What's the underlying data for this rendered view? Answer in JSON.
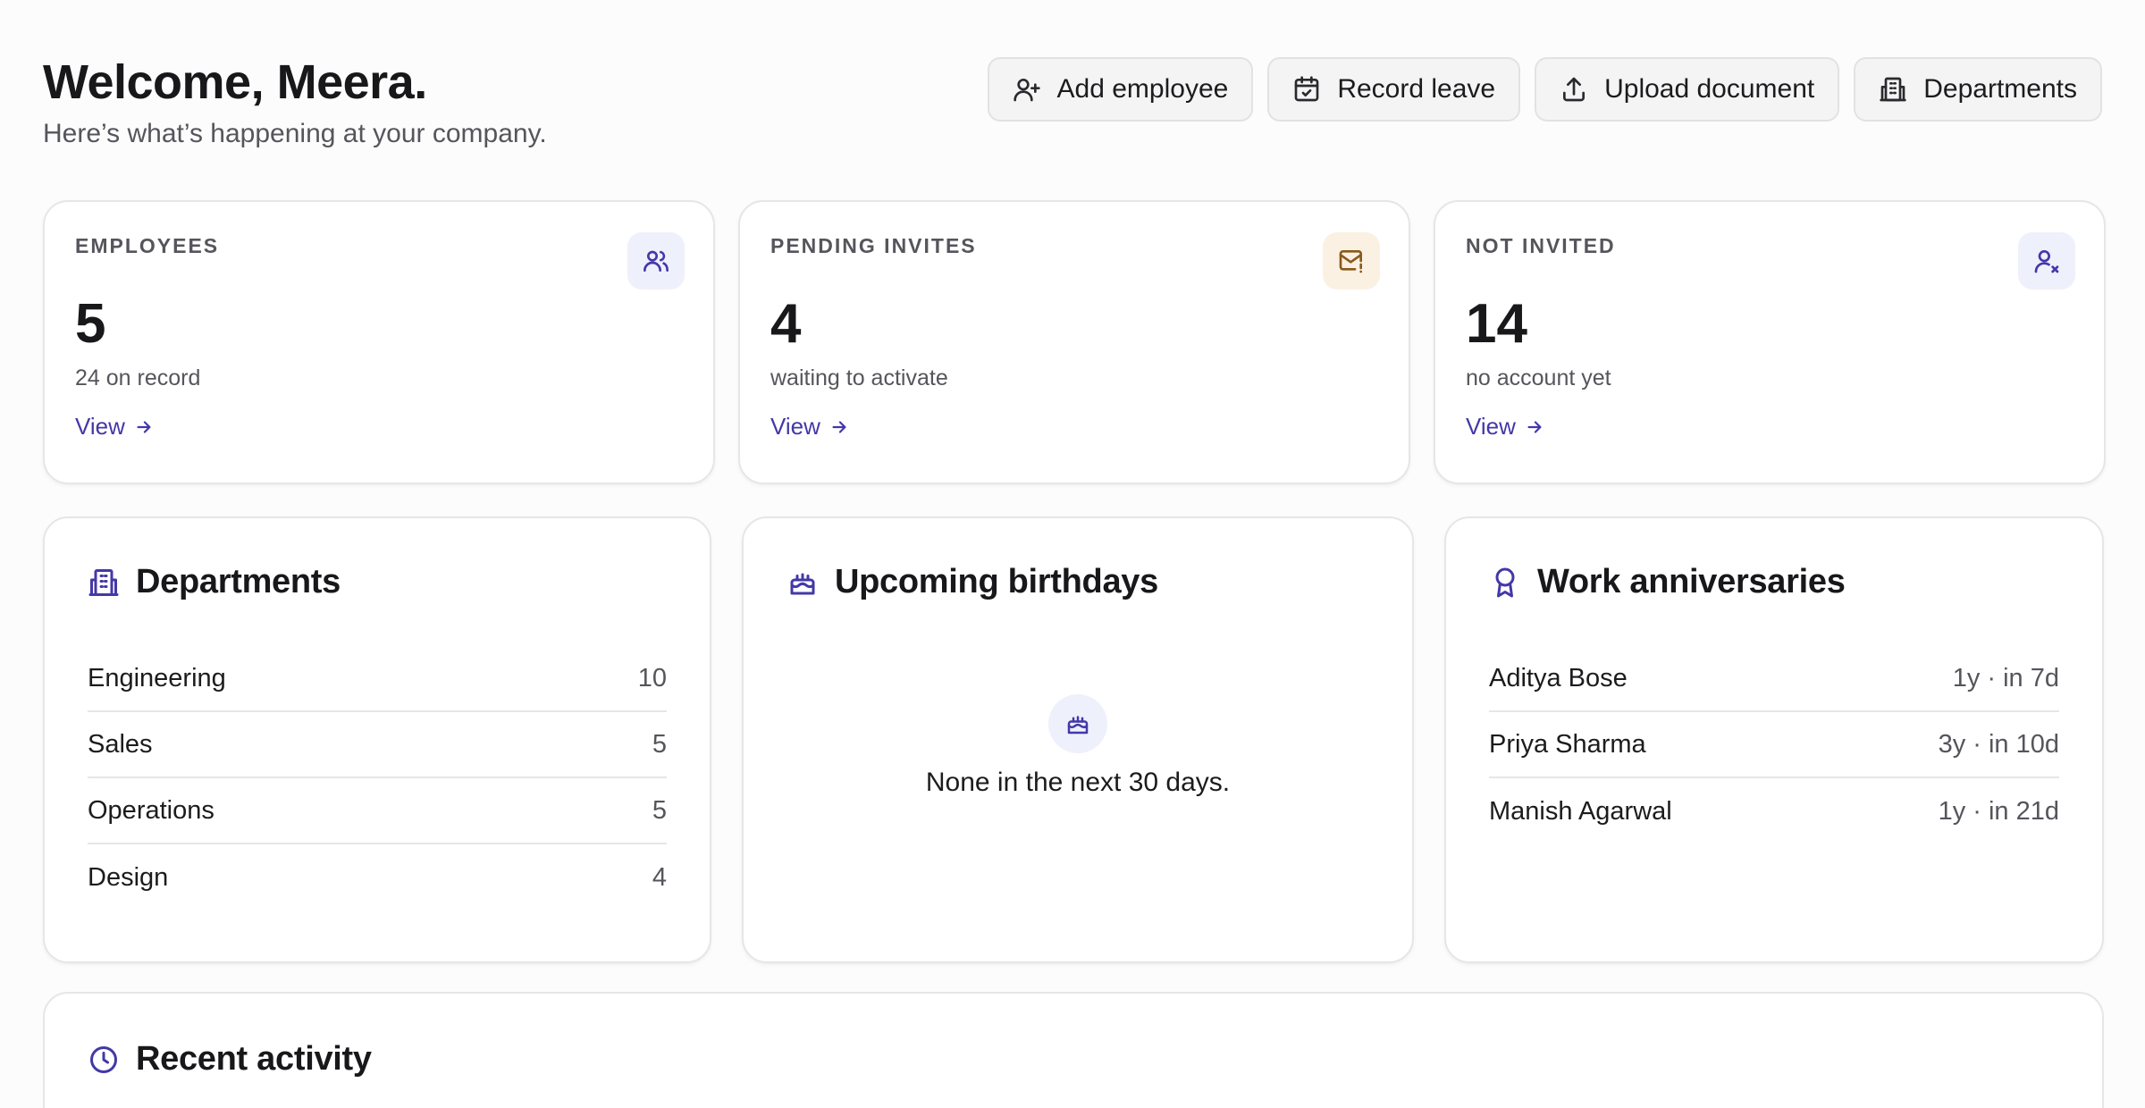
{
  "header": {
    "title": "Welcome, Meera.",
    "subtitle": "Here’s what’s happening at your company."
  },
  "actions": {
    "add_employee": "Add employee",
    "record_leave": "Record leave",
    "upload_document": "Upload document",
    "departments": "Departments"
  },
  "stats": [
    {
      "label": "EMPLOYEES",
      "value": "5",
      "sub": "24 on record",
      "link": "View",
      "icon": "users-icon",
      "accent": "#eef0fb"
    },
    {
      "label": "PENDING INVITES",
      "value": "4",
      "sub": "waiting to activate",
      "link": "View",
      "icon": "mail-alert-icon",
      "accent": "#fbf1e3"
    },
    {
      "label": "NOT INVITED",
      "value": "14",
      "sub": "no account yet",
      "link": "View",
      "icon": "user-x-icon",
      "accent": "#eef0fb"
    }
  ],
  "departments": {
    "title": "Departments",
    "items": [
      {
        "name": "Engineering",
        "count": "10"
      },
      {
        "name": "Sales",
        "count": "5"
      },
      {
        "name": "Operations",
        "count": "5"
      },
      {
        "name": "Design",
        "count": "4"
      }
    ]
  },
  "birthdays": {
    "title": "Upcoming birthdays",
    "empty_text": "None in the next 30 days."
  },
  "anniversaries": {
    "title": "Work anniversaries",
    "items": [
      {
        "name": "Aditya Bose",
        "detail": "1y · in 7d"
      },
      {
        "name": "Priya Sharma",
        "detail": "3y · in 10d"
      },
      {
        "name": "Manish Agarwal",
        "detail": "1y · in 21d"
      }
    ]
  },
  "activity": {
    "title": "Recent activity"
  },
  "colors": {
    "accent": "#4338a8",
    "border": "#e6e6e8",
    "warm_tint": "#fbf1e3",
    "cool_tint": "#eef0fb"
  }
}
